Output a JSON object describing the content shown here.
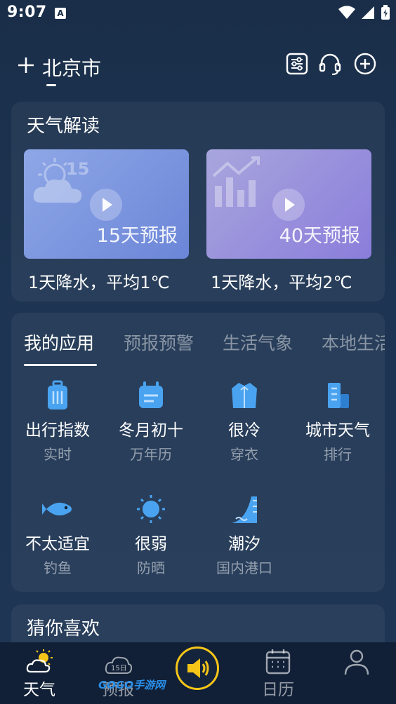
{
  "status_bar": {
    "time": "9:07",
    "notification_badge": "A"
  },
  "header": {
    "city": "北京市",
    "icons": [
      "add-city-icon",
      "settings-sliders-icon",
      "headset-icon",
      "add-circle-icon"
    ]
  },
  "weather_interpretation": {
    "title": "天气解读",
    "videos": [
      {
        "label": "15天预报",
        "caption": "1天降水，平均1℃",
        "badge": "15",
        "gradient": [
          "#7f9be0",
          "#6d86d6"
        ]
      },
      {
        "label": "40天预报",
        "caption": "1天降水，平均2℃",
        "gradient": [
          "#9a9ad8",
          "#8477da"
        ]
      }
    ]
  },
  "apps_section": {
    "tabs": [
      "我的应用",
      "预报预警",
      "生活气象",
      "本地生活"
    ],
    "active_tab": 0,
    "items": [
      {
        "title": "出行指数",
        "sub": "实时",
        "icon": "luggage-icon"
      },
      {
        "title": "冬月初十",
        "sub": "万年历",
        "icon": "calendar-icon"
      },
      {
        "title": "很冷",
        "sub": "穿衣",
        "icon": "coat-icon"
      },
      {
        "title": "城市天气",
        "sub": "排行",
        "icon": "building-icon"
      },
      {
        "title": "不太适宜",
        "sub": "钓鱼",
        "icon": "fish-icon"
      },
      {
        "title": "很弱",
        "sub": "防晒",
        "icon": "sun-icon"
      },
      {
        "title": "潮汐",
        "sub": "国内港口",
        "icon": "tide-icon"
      }
    ]
  },
  "recommend": {
    "title": "猜你喜欢"
  },
  "bottom_nav": {
    "items": [
      {
        "label": "天气",
        "icon": "weather-icon",
        "active": true
      },
      {
        "label": "预报",
        "icon": "forecast-15-icon",
        "active": false
      },
      {
        "label": "",
        "icon": "speaker-icon",
        "active": false
      },
      {
        "label": "日历",
        "icon": "calendar-nav-icon",
        "active": false
      },
      {
        "label": "",
        "icon": "profile-icon",
        "active": false
      }
    ],
    "forecast_badge": "15日",
    "watermark": "GOGO手游网"
  },
  "colors": {
    "background": "#1d3452",
    "accent_blue": "#4aa3f0",
    "voice_ring": "#f5c518"
  }
}
